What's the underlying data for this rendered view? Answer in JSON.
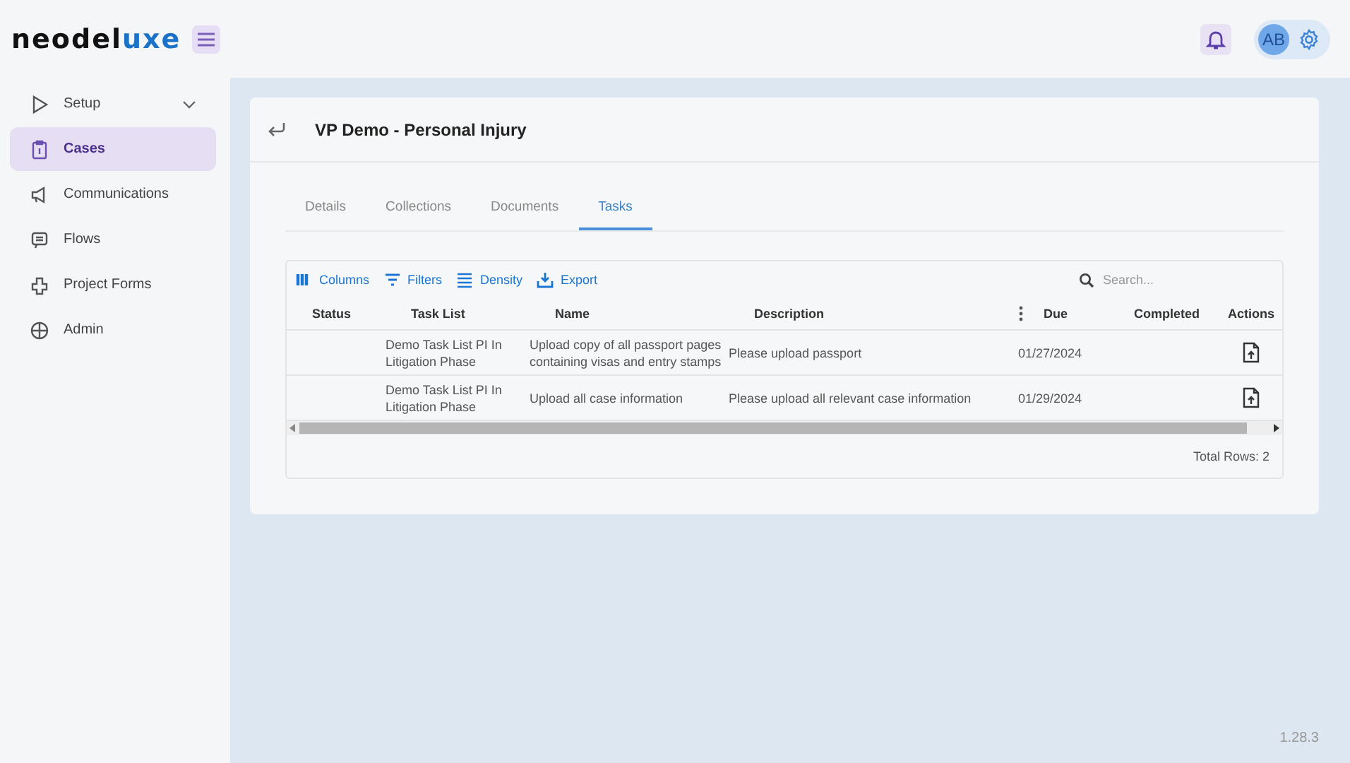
{
  "header": {
    "logo_main": "neodel",
    "logo_accent": "uxe",
    "avatar_initials": "AB"
  },
  "sidebar": {
    "items": [
      {
        "label": "Setup",
        "selected": false,
        "expandable": true
      },
      {
        "label": "Cases",
        "selected": true,
        "expandable": false
      },
      {
        "label": "Communications",
        "selected": false,
        "expandable": false
      },
      {
        "label": "Flows",
        "selected": false,
        "expandable": false
      },
      {
        "label": "Project Forms",
        "selected": false,
        "expandable": false
      },
      {
        "label": "Admin",
        "selected": false,
        "expandable": false
      }
    ]
  },
  "page": {
    "title": "VP Demo - Personal Injury",
    "tabs": [
      {
        "label": "Details",
        "selected": false
      },
      {
        "label": "Collections",
        "selected": false
      },
      {
        "label": "Documents",
        "selected": false
      },
      {
        "label": "Tasks",
        "selected": true
      }
    ],
    "toolbar": [
      {
        "label": "Columns"
      },
      {
        "label": "Filters"
      },
      {
        "label": "Density"
      },
      {
        "label": "Export"
      }
    ],
    "search": {
      "placeholder": "Search..."
    },
    "table": {
      "columns": [
        "Status",
        "Task List",
        "Name",
        "Description",
        "Due",
        "Completed",
        "Actions"
      ],
      "rows": [
        {
          "task_list": "Demo Task List PI In Litigation Phase",
          "name": "Upload copy of all passport pages containing visas and entry stamps",
          "description": "Please upload passport",
          "due": "01/27/2024"
        },
        {
          "task_list": "Demo Task List PI In Litigation Phase",
          "name": "Upload all case information",
          "description": "Please upload all relevant case information",
          "due": "01/29/2024"
        }
      ]
    },
    "total_rows": "Total Rows: 2"
  },
  "version": "1.28.3"
}
